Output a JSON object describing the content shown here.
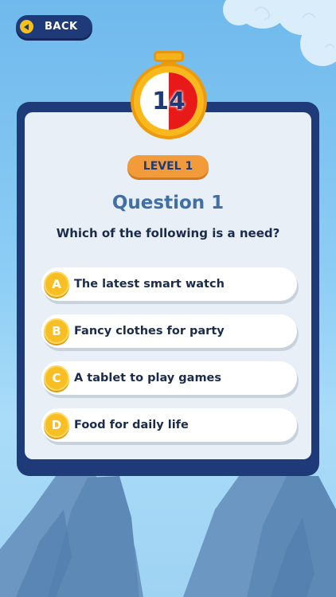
{
  "header": {
    "back_label": "BACK"
  },
  "timer": {
    "seconds_left": "14",
    "elapsed_fraction": 0.5,
    "colors": {
      "elapsed": "#e81919",
      "remaining": "#ffffff",
      "ring": "#f9b81c"
    }
  },
  "level": {
    "label": "LEVEL 1"
  },
  "question": {
    "title": "Question 1",
    "text": "Which of the following is a need?"
  },
  "answers": [
    {
      "letter": "A",
      "text": "The latest smart watch"
    },
    {
      "letter": "B",
      "text": "Fancy clothes for party"
    },
    {
      "letter": "C",
      "text": "A tablet to play games"
    },
    {
      "letter": "D",
      "text": "Food for daily life"
    }
  ],
  "colors": {
    "navy": "#1e3a78",
    "accent_orange": "#f29b3b",
    "badge_yellow": "#f8bf24",
    "title_blue": "#3f6fa6"
  },
  "icons": {
    "back": "arrow-left-icon",
    "timer": "stopwatch-icon"
  }
}
